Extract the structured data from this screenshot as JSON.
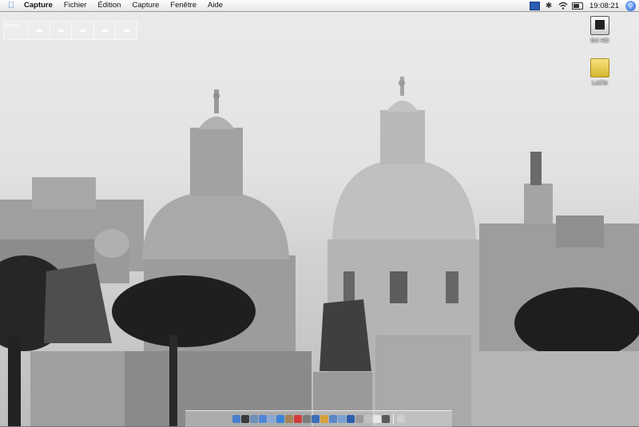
{
  "menubar": {
    "apple_icon": "apple-logo-icon",
    "app_name": "Capture",
    "menus": [
      "Fichier",
      "Édition",
      "Capture",
      "Fenêtre",
      "Aide"
    ],
    "status_icons": [
      "input-menu-flag-icon",
      "bluetooth-icon",
      "wifi-icon",
      "battery-icon"
    ],
    "clock": "19:08:21",
    "spotlight_icon": "spotlight-search-icon"
  },
  "weather_widget": {
    "city": "Bourges",
    "days": [
      {
        "icon": "cloud-icon"
      },
      {
        "icon": "cloud-icon"
      },
      {
        "icon": "cloud-icon"
      },
      {
        "icon": "cloud-icon"
      },
      {
        "icon": "cloud-icon"
      }
    ]
  },
  "desktop_icons": [
    {
      "label": "G4 HD",
      "icon": "hard-drive-icon"
    },
    {
      "label": "LaCie",
      "icon": "external-drive-icon"
    }
  ],
  "dock": {
    "items": [
      {
        "name": "finder",
        "color": "#4a7fd0"
      },
      {
        "name": "dashboard",
        "color": "#3a3a3a"
      },
      {
        "name": "mail",
        "color": "#6d8fb8"
      },
      {
        "name": "safari",
        "color": "#4f86d6"
      },
      {
        "name": "ichat",
        "color": "#8aa9d6"
      },
      {
        "name": "itunes",
        "color": "#3a83d8"
      },
      {
        "name": "iphoto",
        "color": "#a6835a"
      },
      {
        "name": "ical",
        "color": "#d43a3a"
      },
      {
        "name": "system-preferences",
        "color": "#7a7a7a"
      },
      {
        "name": "quicktime",
        "color": "#3d6fb8"
      },
      {
        "name": "app-1",
        "color": "#d6a13a"
      },
      {
        "name": "app-2",
        "color": "#5a86c6"
      },
      {
        "name": "app-3",
        "color": "#7aa0d4"
      },
      {
        "name": "app-4",
        "color": "#2d5fb0"
      },
      {
        "name": "app-5",
        "color": "#9a9a9a"
      },
      {
        "name": "app-6",
        "color": "#c0c0c0"
      },
      {
        "name": "app-7",
        "color": "#e8e8e8"
      },
      {
        "name": "app-8",
        "color": "#5b5b5b"
      },
      {
        "name": "trash",
        "color": "#cfcfcf"
      }
    ]
  }
}
